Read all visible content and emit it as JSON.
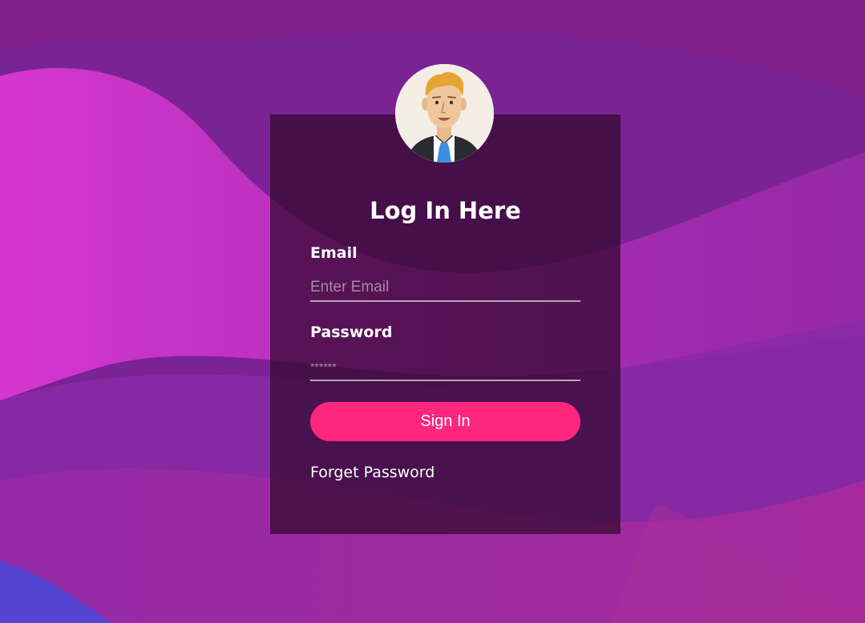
{
  "login": {
    "title": "Log In Here",
    "email_label": "Email",
    "email_placeholder": "Enter Email",
    "password_label": "Password",
    "password_placeholder": "******",
    "signin_label": "Sign In",
    "forget_label": "Forget Password"
  },
  "colors": {
    "accent": "#ff267e",
    "card": "#32082d",
    "text": "#ffffff"
  },
  "icons": {
    "avatar": "user-avatar-businessman"
  }
}
